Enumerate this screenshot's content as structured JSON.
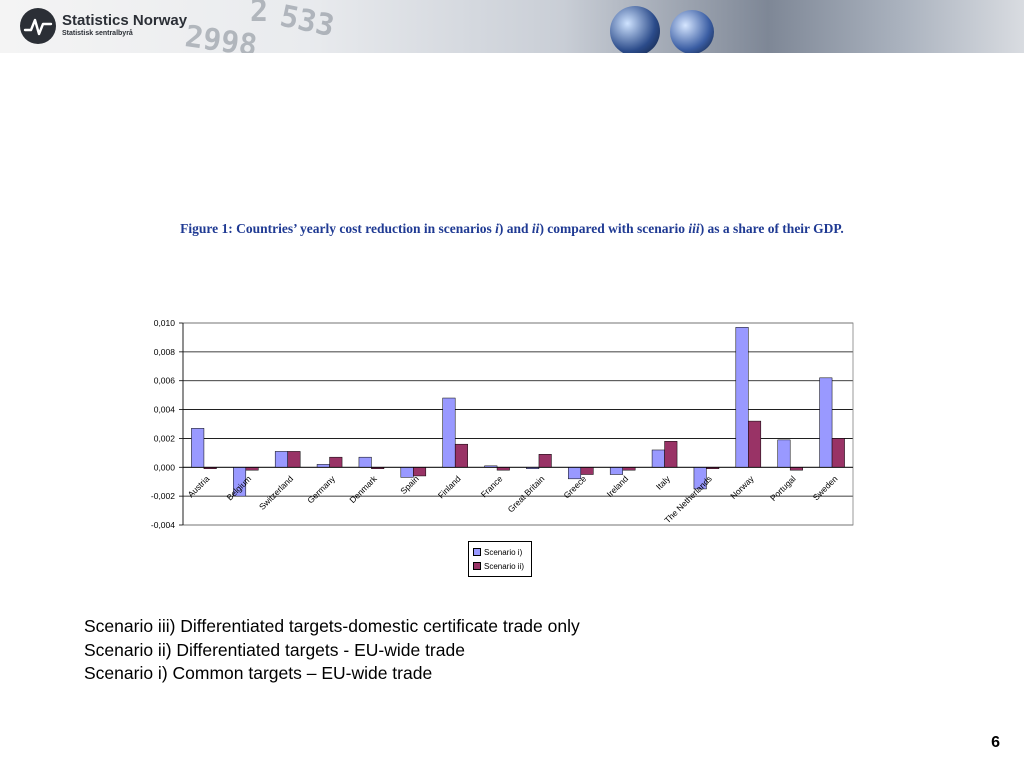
{
  "header": {
    "org_name": "Statistics Norway",
    "org_subtitle": "Statistisk sentralbyrå",
    "logo_icon": "ssb-logo-icon",
    "banner_image": "banner-photo"
  },
  "figure": {
    "title_parts": [
      {
        "text": "Figure 1: Countries’ yearly cost reduction in scenarios ",
        "italic": false
      },
      {
        "text": "i",
        "italic": true
      },
      {
        "text": ") and ",
        "italic": false
      },
      {
        "text": "ii",
        "italic": true
      },
      {
        "text": ") compared with scenario ",
        "italic": false
      },
      {
        "text": "iii",
        "italic": true
      },
      {
        "text": ") as a share of their GDP.",
        "italic": false
      }
    ],
    "title_color": "#1f3a93"
  },
  "chart_data": {
    "type": "bar",
    "title": "",
    "xlabel": "",
    "ylabel": "",
    "categories": [
      "Austria",
      "Belgium",
      "Switzerland",
      "Germany",
      "Denmark",
      "Spain",
      "Finland",
      "France",
      "Great Britain",
      "Greece",
      "Ireland",
      "Italy",
      "The Netherlands",
      "Norway",
      "Portugal",
      "Sweden"
    ],
    "series": [
      {
        "name": "Scenario i)",
        "color": "#9999ff",
        "values": [
          0.0027,
          -0.002,
          0.0011,
          0.0002,
          0.0007,
          -0.0007,
          0.0048,
          0.0001,
          -0.0001,
          -0.0008,
          -0.0005,
          0.0012,
          -0.0015,
          0.0097,
          0.0019,
          0.0062
        ]
      },
      {
        "name": "Scenario ii)",
        "color": "#993366",
        "values": [
          -0.0001,
          -0.0002,
          0.0011,
          0.0007,
          -0.0001,
          -0.0006,
          0.0016,
          -0.0002,
          0.0009,
          -0.0005,
          -0.0002,
          0.0018,
          -0.0001,
          0.0032,
          -0.0002,
          0.002
        ]
      }
    ],
    "ylim": [
      -0.004,
      0.01
    ],
    "yticks": [
      0.01,
      0.008,
      0.006,
      0.004,
      0.002,
      0.0,
      -0.002,
      -0.004
    ],
    "ytick_labels": [
      "0,010",
      "0,008",
      "0,006",
      "0,004",
      "0,002",
      "0,000",
      "-0,002",
      "-0,004"
    ],
    "grid": true,
    "legend_position": "bottom"
  },
  "notes": [
    "Scenario iii) Differentiated targets-domestic certificate trade only",
    "Scenario ii) Differentiated targets - EU-wide trade",
    "Scenario i) Common targets – EU-wide trade"
  ],
  "page_number": "6"
}
